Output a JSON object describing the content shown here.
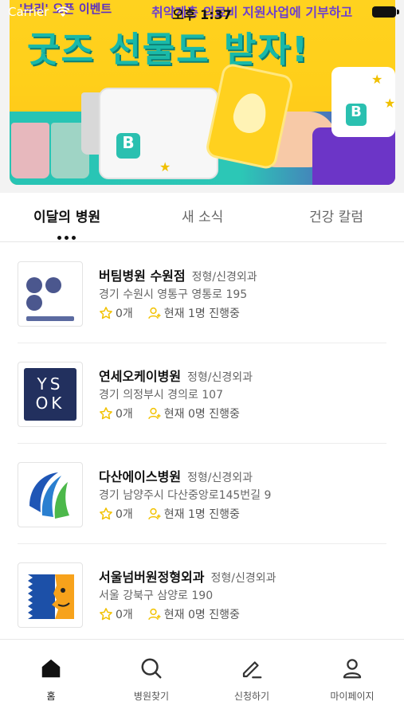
{
  "status_bar": {
    "carrier": "Carrier",
    "time": "오후 1:37"
  },
  "banner": {
    "top_left_text": "'브리' 오픈 이벤트",
    "top_right_text": "취약계층 의료비 지원사업에 기부하고",
    "headline": "굿즈 선물도 받자!",
    "accent": "#19b9a8"
  },
  "tabs": [
    {
      "label": "이달의 병원",
      "active": true
    },
    {
      "label": "새 소식",
      "active": false
    },
    {
      "label": "건강 칼럼",
      "active": false
    }
  ],
  "hospitals": [
    {
      "name": "버팀병원 수원점",
      "category": "정형/신경외과",
      "address": "경기 수원시 영통구 영통로 195",
      "rating_count": "0개",
      "in_progress": "현재 1명 진행중"
    },
    {
      "name": "연세오케이병원",
      "category": "정형/신경외과",
      "address": "경기 의정부시 경의로 107",
      "rating_count": "0개",
      "in_progress": "현재 0명 진행중",
      "logo_text_1": "YS",
      "logo_text_2": "OK"
    },
    {
      "name": "다산에이스병원",
      "category": "정형/신경외과",
      "address": "경기 남양주시 다산중앙로145번길 9",
      "rating_count": "0개",
      "in_progress": "현재 1명 진행중"
    },
    {
      "name": "서울넘버원정형외과",
      "category": "정형/신경외과",
      "address": "서울 강북구 삼양로 190",
      "rating_count": "0개",
      "in_progress": "현재 0명 진행중"
    }
  ],
  "bottom_nav": [
    {
      "label": "홈",
      "icon": "home-icon",
      "active": true
    },
    {
      "label": "병원찾기",
      "icon": "search-icon",
      "active": false
    },
    {
      "label": "신청하기",
      "icon": "pencil-icon",
      "active": false
    },
    {
      "label": "마이페이지",
      "icon": "user-icon",
      "active": false
    }
  ],
  "colors": {
    "star": "#f2c200",
    "user_icon": "#f2c200",
    "nav_active": "#111111"
  }
}
